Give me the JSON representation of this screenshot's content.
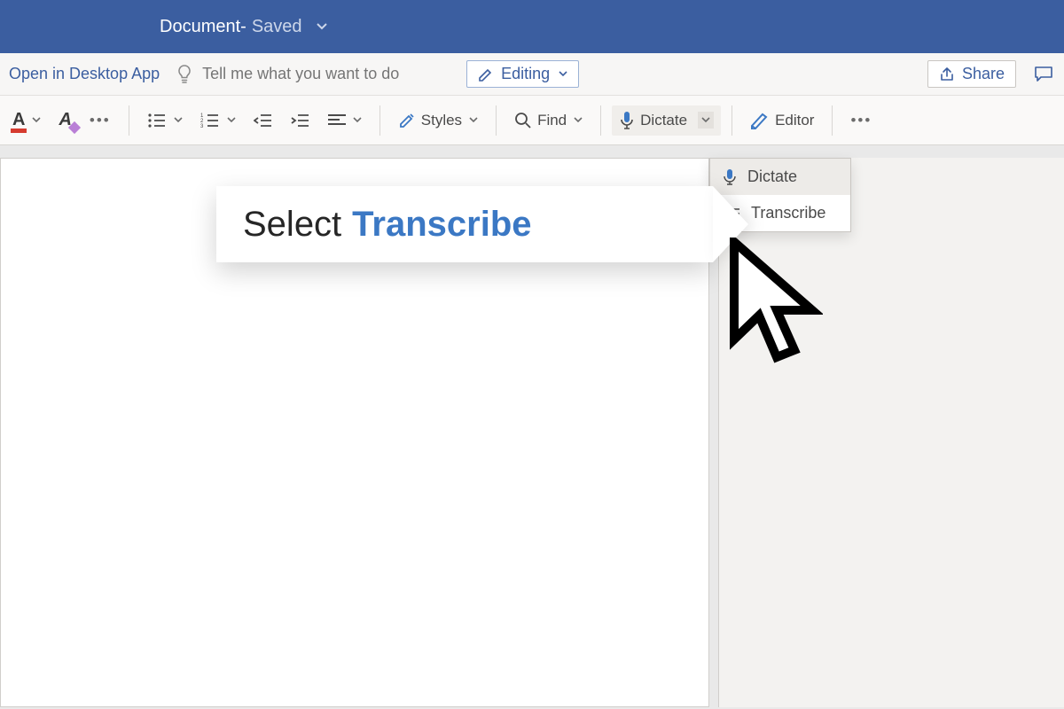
{
  "title": {
    "doc": "Document",
    "dash": "  -  ",
    "status": "Saved"
  },
  "toprow": {
    "open_desktop": "Open in Desktop App",
    "search_placeholder": "Tell me what you want to do",
    "editing": "Editing",
    "share": "Share"
  },
  "ribbon": {
    "styles": "Styles",
    "find": "Find",
    "dictate": "Dictate",
    "editor": "Editor"
  },
  "dropdown": {
    "dictate": "Dictate",
    "transcribe": "Transcribe"
  },
  "callout": {
    "a": "Select",
    "b": "Transcribe"
  }
}
